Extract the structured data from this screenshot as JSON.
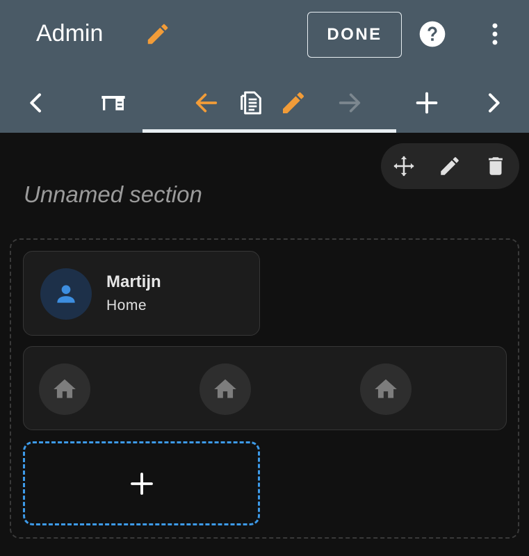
{
  "header": {
    "title": "Admin",
    "done_label": "DONE",
    "icons": {
      "edit": "pencil-icon",
      "help": "help-circle-icon",
      "more": "dots-vertical-icon"
    }
  },
  "toolbar": {
    "icons": [
      "chevron-left-icon",
      "desk-icon",
      "arrow-left-icon",
      "sections-icon",
      "pencil-icon",
      "arrow-right-icon",
      "plus-icon",
      "chevron-right-icon"
    ]
  },
  "section": {
    "title": "Unnamed section",
    "tools": [
      "move-icon",
      "pencil-icon",
      "delete-icon"
    ]
  },
  "person_card": {
    "name": "Martijn",
    "state": "Home",
    "icon": "account-icon"
  },
  "tiles": {
    "icons": [
      "home-icon",
      "home-icon",
      "home-icon"
    ]
  },
  "add_card": {
    "icon": "plus-icon"
  },
  "colors": {
    "header_bg": "#4a5a66",
    "accent_orange": "#f29c38",
    "accent_blue": "#3d9ae8",
    "background": "#111111"
  }
}
